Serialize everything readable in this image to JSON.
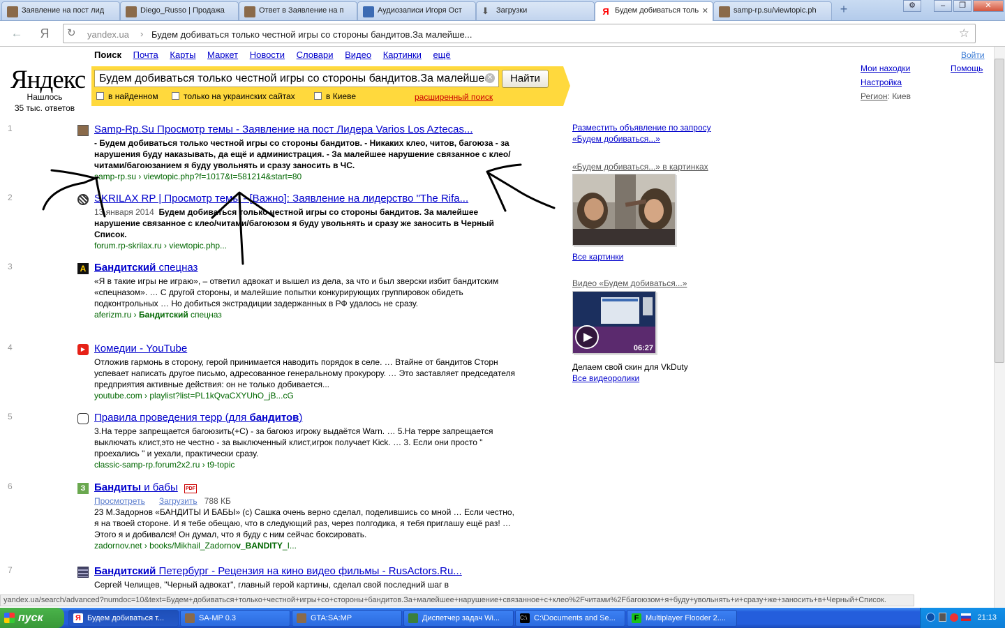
{
  "browser": {
    "tabs": [
      {
        "label": "Заявление на пост лид",
        "active": false
      },
      {
        "label": "Diego_Russo | Продажа",
        "active": false
      },
      {
        "label": "Ответ в Заявление на п",
        "active": false
      },
      {
        "label": "Аудиозаписи Игоря Ост",
        "active": false
      },
      {
        "label": "Загрузки",
        "active": false
      },
      {
        "label": "Будем добиваться толь",
        "active": true
      },
      {
        "label": "samp-rp.su/viewtopic.ph",
        "active": false
      }
    ],
    "url_host": "yandex.ua",
    "url_separator": "›",
    "url_path": "Будем добиваться только честной игры со стороны бандитов.За малейше..."
  },
  "yandex": {
    "logo": "Яндекс",
    "found": "Нашлось",
    "found_count": "35 тыс. ответов",
    "services": [
      "Поиск",
      "Почта",
      "Карты",
      "Маркет",
      "Новости",
      "Словари",
      "Видео",
      "Картинки",
      "ещё"
    ],
    "search_query": "Будем добиваться только честной игры со стороны бандитов.За малейшее",
    "search_button": "Найти",
    "checkboxes": [
      "в найденном",
      "только на украинских сайтах",
      "в Киеве"
    ],
    "advanced_search": "расширенный поиск",
    "login": "Войти",
    "my_finds": "Мои находки",
    "help": "Помощь",
    "settings": "Настройка",
    "region_label": "Регион",
    "region_value": ": Киев"
  },
  "results": [
    {
      "num": "1",
      "title": "Samp-Rp.Su Просмотр темы - Заявление на пост Лидера Varios Los Aztecas..."
    },
    {
      "num": "2",
      "title": "SKRILAX RP | Просмотр темы - [Важно]: Заявление на лидерство \"The Rifa..."
    },
    {
      "num": "3",
      "title_b": "Бандитский",
      "title_rest": " спецназ",
      "url_host": "aferizm.ru",
      "url_rest_b": "Бандитский",
      "url_rest": " спецназ"
    },
    {
      "num": "4",
      "title": "Комедии - YouTube",
      "url": "youtube.com › playlist?list=PL1kQvaCXYUhO_jB...cG"
    },
    {
      "num": "5",
      "title_a": "Правила проведения терр (для ",
      "title_b": "бандитов",
      "title_c": ")",
      "url": "classic-samp-rp.forum2x2.ru › t9-topic"
    },
    {
      "num": "6",
      "title_b": "Бандиты",
      "title_rest": " и бабы",
      "view": "Просмотреть",
      "download": "Загрузить",
      "size": "788 КБ"
    },
    {
      "num": "7",
      "title_b": "Бандитский",
      "title_rest": " Петербург - Рецензия на кино видео фильмы - RusActors.Ru..."
    }
  ],
  "snippets": {
    "r1": "- Будем добиваться только честной игры со стороны бандитов. - Никаких клео, читов, багоюза - за нарушения буду наказывать, да ещё и администрация. - За малейшее нарушение связанное с клео/читами/багоюзанием я буду увольнять и сразу заносить в ЧС.",
    "r1_url": "samp-rp.su › viewtopic.php?f=1017&t=581214&start=80",
    "r2_date": "13 января 2014",
    "r2": "Будем добиваться только честной игры со стороны бандитов. За малейшее нарушение связанное с клео/читами/багоюзом я буду увольнять и сразу же заносить в Черный Список.",
    "r2_url": "forum.rp-skrilax.ru › viewtopic.php...",
    "r3": "«Я в такие игры не играю», – ответил адвокат и вышел из дела, за что и был зверски избит бандитским «спецназом». … С другой стороны, и малейшие попытки конкурирующих группировок обидеть подконтрольных … Но добиться экстрадиции задержанных в РФ удалось не сразу.",
    "r4": "Отложив гармонь в сторону, герой принимается наводить порядок в селе. … Втайне от бандитов Сторн успевает написать другое письмо, адресованное генеральному прокурору. … Это заставляет председателя предприятия активные действия: он не только добивается...",
    "r5": "3.На терре запрещается багоюзить(+С) - за багоюз игроку выдаётся Warn. … 5.На терре запрещается выключать клист,это не честно - за выключенный клист,игрок получает Kick. … 3. Если они просто \" проехались \" и уехали, практически сразу.",
    "r6": "23 М.Задорнов «БАНДИТЫ И БАБЫ» (с) Сашка очень верно сделал, поделившись со мной … Если честно, я на твоей стороне. И я тебе обещаю, что в следующий раз, через полгодика, я тебя приглашу ещё раз! … Этого я и добивался! Он думал, что я буду с ним сейчас боксировать.",
    "r6_url_a": "zadornov.net › books/Mikhail_Zadorno",
    "r6_url_b": "v_BANDITY",
    "r6_url_c": "_I...",
    "r7": "Сергей Челищев, \"Черный адвокат\", главный герой картины, сделал свой последний шаг в"
  },
  "right_column": {
    "ad_line1": "Разместить объявление по запросу",
    "ad_line2": "«Будем добиваться...»",
    "images_title": "«Будем добиваться...» в картинках",
    "all_images": "Все картинки",
    "video_title": "Видео «Будем добиваться...»",
    "video_duration": "06:27",
    "video_caption": "Делаем свой скин для VkDuty",
    "all_videos": "Все видеоролики"
  },
  "status_bar": "yandex.ua/search/advanced?numdoc=10&text=Будем+добиваться+только+честной+игры+со+стороны+бандитов.За+малейшее+нарушение+связанное+с+клео%2Fчитами%2Fбагоюзом+я+буду+увольнять+и+сразу+же+заносить+в+Черный+Список.",
  "taskbar": {
    "start": "пуск",
    "tasks": [
      "Будем добиваться т...",
      "SA-MP 0.3",
      "GTA:SA:MP",
      "Диспетчер задач Wi...",
      "C:\\Documents and Se...",
      "Multiplayer Flooder 2...."
    ],
    "clock": "21:13"
  },
  "colors": {
    "link": "#0000cc",
    "url_green": "#006600",
    "search_band": "#ffd93d",
    "logo_red": "#ff0000",
    "taskbar_blue": "#245edc",
    "start_green": "#389838"
  }
}
